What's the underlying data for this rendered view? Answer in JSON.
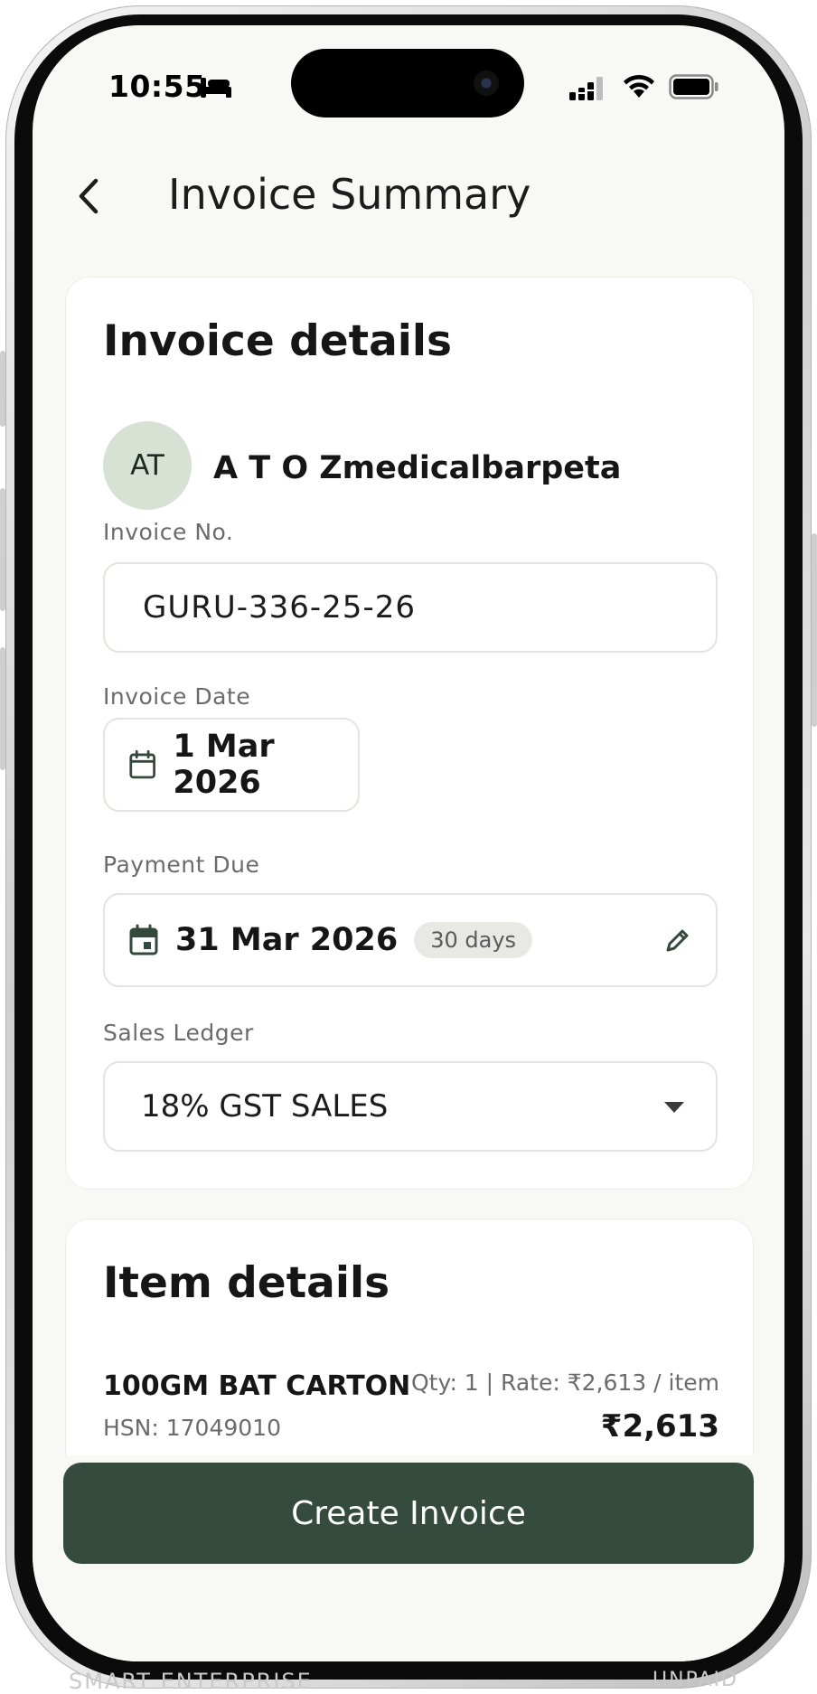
{
  "status_bar": {
    "time": "10:55"
  },
  "header": {
    "title": "Invoice Summary"
  },
  "invoice_details": {
    "title": "Invoice details",
    "customer": {
      "initials": "AT",
      "name": "A T O Zmedicalbarpeta"
    },
    "invoice_no": {
      "label": "Invoice No.",
      "value": "GURU-336-25-26"
    },
    "invoice_date": {
      "label": "Invoice Date",
      "value": "1 Mar 2026"
    },
    "payment_due": {
      "label": "Payment Due",
      "value": "31 Mar 2026",
      "days": "30 days"
    },
    "sales_ledger": {
      "label": "Sales Ledger",
      "value": "18% GST SALES"
    }
  },
  "item_details": {
    "title": "Item details",
    "items": [
      {
        "name": "100GM BAT CARTON",
        "hsn": "HSN: 17049010",
        "meta": "Qty: 1 | Rate: ₹2,613 / item",
        "amount": "₹2,613"
      }
    ]
  },
  "actions": {
    "create_label": "Create Invoice"
  },
  "background_fragments": {
    "left": "SMART ENTERPRISE",
    "right": "UNPAID"
  },
  "colors": {
    "primary": "#344b3e",
    "avatar_bg": "#d7e2d5",
    "screen_bg": "#f8f8f4"
  }
}
